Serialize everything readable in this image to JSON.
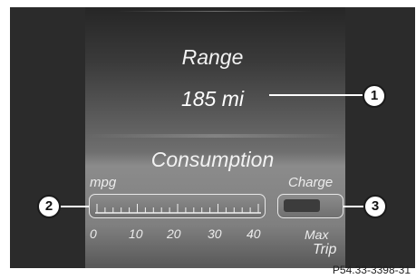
{
  "display": {
    "range_label": "Range",
    "range_value": "185 mi",
    "consumption_label": "Consumption",
    "mpg_label": "mpg",
    "charge_label": "Charge",
    "scale_ticks": [
      "0",
      "10",
      "20",
      "30",
      "40"
    ],
    "max_label": "Max",
    "trip_label": "Trip"
  },
  "callouts": [
    "1",
    "2",
    "3"
  ],
  "figure_code": "P54.33-3398-31",
  "colors": {
    "screen_bg": "#2b2b2b",
    "text": "#ececec",
    "callout_fill": "#ffffff",
    "callout_border": "#1a1a1a"
  }
}
